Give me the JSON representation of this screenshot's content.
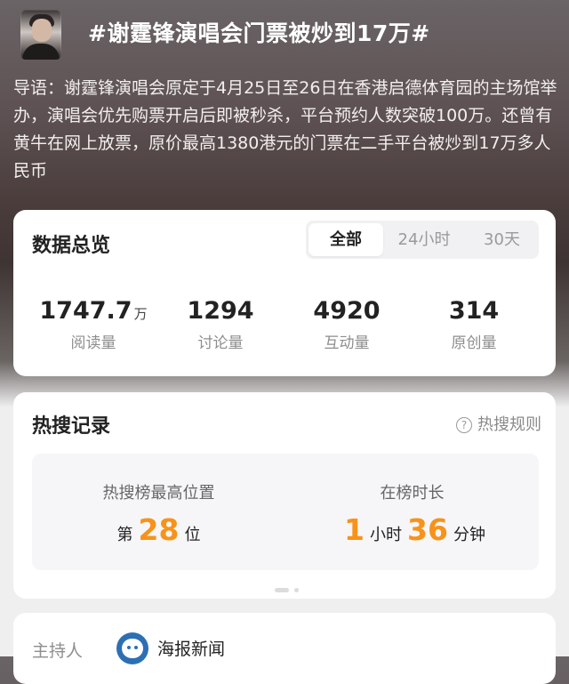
{
  "topic": {
    "title": "#谢霆锋演唱会门票被炒到17万#",
    "intro": "导语：谢霆锋演唱会原定于4月25日至26日在香港启德体育园的主场馆举办，演唱会优先购票开启后即被秒杀，平台预约人数突破100万。还曾有黄牛在网上放票，原价最高1380港元的门票在二手平台被炒到17万多人民币"
  },
  "overview": {
    "heading": "数据总览",
    "tabs": [
      "全部",
      "24小时",
      "30天"
    ],
    "active_tab": "全部",
    "stats": [
      {
        "value": "1747.7",
        "unit": "万",
        "label": "阅读量"
      },
      {
        "value": "1294",
        "unit": "",
        "label": "讨论量"
      },
      {
        "value": "4920",
        "unit": "",
        "label": "互动量"
      },
      {
        "value": "314",
        "unit": "",
        "label": "原创量"
      }
    ]
  },
  "hot_search": {
    "heading": "热搜记录",
    "rules_label": "热搜规则",
    "peak": {
      "label": "热搜榜最高位置",
      "prefix": "第",
      "value": "28",
      "suffix": "位"
    },
    "duration": {
      "label": "在榜时长",
      "hours": "1",
      "hours_unit": "小时",
      "minutes": "36",
      "minutes_unit": "分钟"
    }
  },
  "host": {
    "label": "主持人",
    "name": "海报新闻"
  },
  "colors": {
    "accent_orange": "#f7931a",
    "card_bg": "#ffffff",
    "muted_text": "#8e8e8e"
  }
}
